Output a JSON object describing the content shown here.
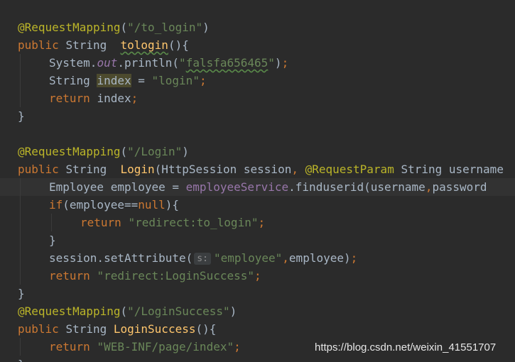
{
  "editor": {
    "lines": [
      {
        "parts": [
          {
            "t": "@RequestMapping",
            "c": "ann"
          },
          {
            "t": "(",
            "c": "plain"
          },
          {
            "t": "\"/to_login\"",
            "c": "str"
          },
          {
            "t": ")",
            "c": "plain"
          }
        ]
      },
      {
        "parts": [
          {
            "t": "public ",
            "c": "kw"
          },
          {
            "t": "String  ",
            "c": "plain"
          },
          {
            "t": "tologin",
            "c": "fn squiggle"
          },
          {
            "t": "(){",
            "c": "plain"
          }
        ]
      },
      {
        "indent": 1,
        "parts": [
          {
            "t": "System.",
            "c": "plain"
          },
          {
            "t": "out",
            "c": "static"
          },
          {
            "t": ".println(",
            "c": "plain"
          },
          {
            "t": "\"",
            "c": "str"
          },
          {
            "t": "falsfa656465",
            "c": "str squiggle"
          },
          {
            "t": "\"",
            "c": "str"
          },
          {
            "t": ")",
            "c": "plain"
          },
          {
            "t": ";",
            "c": "kw"
          }
        ]
      },
      {
        "indent": 1,
        "parts": [
          {
            "t": "String ",
            "c": "plain"
          },
          {
            "t": "index",
            "c": "plain hl-var"
          },
          {
            "t": " = ",
            "c": "plain"
          },
          {
            "t": "\"login\"",
            "c": "str"
          },
          {
            "t": ";",
            "c": "kw"
          }
        ]
      },
      {
        "indent": 1,
        "parts": [
          {
            "t": "return ",
            "c": "kw"
          },
          {
            "t": "index",
            "c": "plain"
          },
          {
            "t": ";",
            "c": "kw"
          }
        ]
      },
      {
        "parts": [
          {
            "t": "}",
            "c": "plain"
          }
        ]
      },
      {
        "parts": []
      },
      {
        "parts": [
          {
            "t": "@RequestMapping",
            "c": "ann"
          },
          {
            "t": "(",
            "c": "plain"
          },
          {
            "t": "\"/Login\"",
            "c": "str"
          },
          {
            "t": ")",
            "c": "plain"
          }
        ]
      },
      {
        "parts": [
          {
            "t": "public ",
            "c": "kw"
          },
          {
            "t": "String  ",
            "c": "plain"
          },
          {
            "t": "Login",
            "c": "fn"
          },
          {
            "t": "(HttpSession session",
            "c": "plain"
          },
          {
            "t": ", ",
            "c": "kw"
          },
          {
            "t": "@RequestParam ",
            "c": "ann"
          },
          {
            "t": "String username",
            "c": "plain"
          }
        ]
      },
      {
        "indent": 1,
        "current": true,
        "parts": [
          {
            "t": "Employee employee = ",
            "c": "plain"
          },
          {
            "t": "employeeService",
            "c": "field"
          },
          {
            "t": ".finduserid(username",
            "c": "plain"
          },
          {
            "t": ",",
            "c": "kw"
          },
          {
            "t": "password",
            "c": "plain"
          }
        ]
      },
      {
        "indent": 1,
        "parts": [
          {
            "t": "if",
            "c": "kw"
          },
          {
            "t": "(employee==",
            "c": "plain"
          },
          {
            "t": "null",
            "c": "kw"
          },
          {
            "t": "){",
            "c": "plain"
          }
        ]
      },
      {
        "indent": 2,
        "parts": [
          {
            "t": "return ",
            "c": "kw"
          },
          {
            "t": "\"redirect:to_login\"",
            "c": "str"
          },
          {
            "t": ";",
            "c": "kw"
          }
        ]
      },
      {
        "indent": 1,
        "parts": [
          {
            "t": "}",
            "c": "plain"
          }
        ]
      },
      {
        "indent": 1,
        "parts": [
          {
            "t": "session.setAttribute(",
            "c": "plain"
          },
          {
            "t": "s:",
            "c": "hint"
          },
          {
            "t": "\"employee\"",
            "c": "str"
          },
          {
            "t": ",",
            "c": "kw"
          },
          {
            "t": "employee)",
            "c": "plain"
          },
          {
            "t": ";",
            "c": "kw"
          }
        ]
      },
      {
        "indent": 1,
        "parts": [
          {
            "t": "return ",
            "c": "kw"
          },
          {
            "t": "\"redirect:LoginSuccess\"",
            "c": "str"
          },
          {
            "t": ";",
            "c": "kw"
          }
        ]
      },
      {
        "parts": [
          {
            "t": "}",
            "c": "plain"
          }
        ]
      },
      {
        "parts": [
          {
            "t": "@RequestMapping",
            "c": "ann"
          },
          {
            "t": "(",
            "c": "plain"
          },
          {
            "t": "\"/LoginSuccess\"",
            "c": "str"
          },
          {
            "t": ")",
            "c": "plain"
          }
        ]
      },
      {
        "parts": [
          {
            "t": "public ",
            "c": "kw"
          },
          {
            "t": "String ",
            "c": "plain"
          },
          {
            "t": "LoginSuccess",
            "c": "fn"
          },
          {
            "t": "(){",
            "c": "plain"
          }
        ]
      },
      {
        "indent": 1,
        "parts": [
          {
            "t": "return ",
            "c": "kw"
          },
          {
            "t": "\"WEB-INF/page/index\"",
            "c": "str"
          },
          {
            "t": ";",
            "c": "kw"
          }
        ]
      },
      {
        "parts": [
          {
            "t": "}",
            "c": "plain"
          }
        ]
      }
    ]
  },
  "watermark": "https://blog.csdn.net/weixin_41551707"
}
